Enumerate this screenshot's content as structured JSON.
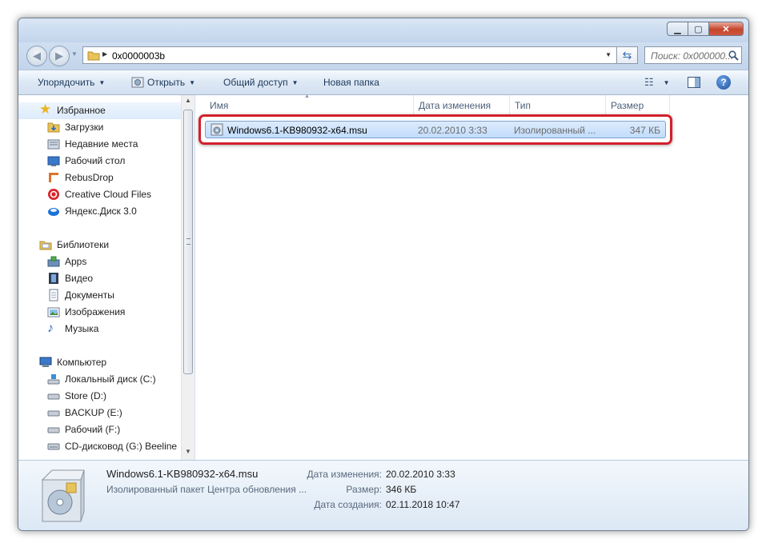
{
  "address": {
    "path": "0x0000003b"
  },
  "search": {
    "placeholder": "Поиск: 0x000000..."
  },
  "toolbar": {
    "organize": "Упорядочить",
    "open": "Открыть",
    "share": "Общий доступ",
    "new_folder": "Новая папка"
  },
  "nav": {
    "favorites": {
      "label": "Избранное",
      "items": [
        "Загрузки",
        "Недавние места",
        "Рабочий стол",
        "RebusDrop",
        "Creative Cloud Files",
        "Яндекс.Диск 3.0"
      ]
    },
    "libraries": {
      "label": "Библиотеки",
      "items": [
        "Apps",
        "Видео",
        "Документы",
        "Изображения",
        "Музыка"
      ]
    },
    "computer": {
      "label": "Компьютер",
      "items": [
        "Локальный диск (C:)",
        "Store (D:)",
        "BACKUP (E:)",
        "Рабочий (F:)",
        "CD-дисковод (G:) Beeline"
      ]
    }
  },
  "columns": {
    "name": "Имя",
    "date": "Дата изменения",
    "type": "Тип",
    "size": "Размер"
  },
  "files": [
    {
      "name": "Windows6.1-KB980932-x64.msu",
      "date": "20.02.2010 3:33",
      "type": "Изолированный ...",
      "size": "347 КБ"
    }
  ],
  "details": {
    "name": "Windows6.1-KB980932-x64.msu",
    "type": "Изолированный пакет Центра обновления ...",
    "modified_label": "Дата изменения:",
    "modified_value": "20.02.2010 3:33",
    "size_label": "Размер:",
    "size_value": "346 КБ",
    "created_label": "Дата создания:",
    "created_value": "02.11.2018 10:47"
  },
  "colors": {
    "highlight": "#d3202b",
    "selection": "#cce4fc",
    "toolbar_text": "#1e395b"
  }
}
